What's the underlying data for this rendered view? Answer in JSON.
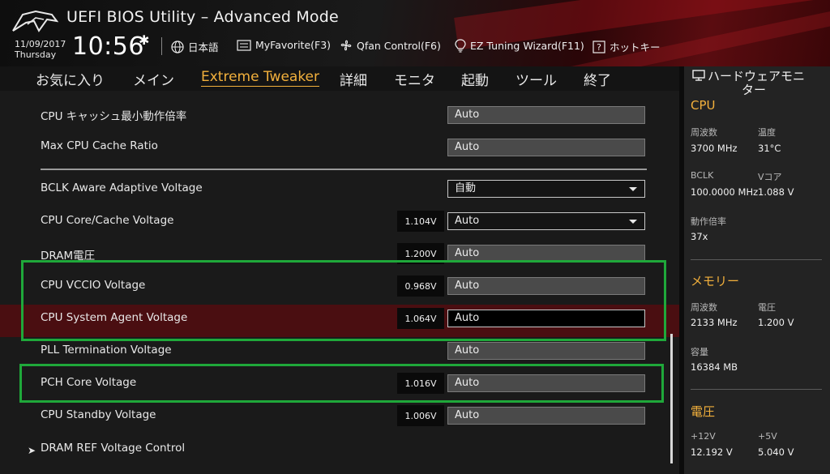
{
  "header": {
    "title": "UEFI BIOS Utility – Advanced Mode",
    "date": "11/09/2017",
    "day": "Thursday",
    "time": "10:56",
    "language": "日本語",
    "myfavorite": "MyFavorite(F3)",
    "qfan": "Qfan Control(F6)",
    "ez_tuning": "EZ Tuning Wizard(F11)",
    "hotkey": "ホットキー"
  },
  "nav": {
    "tabs": [
      "お気に入り",
      "メイン",
      "Extreme Tweaker",
      "詳細",
      "モニタ",
      "起動",
      "ツール",
      "終了"
    ],
    "active": "Extreme Tweaker"
  },
  "settings": [
    {
      "label": "CPU キャッシュ最小動作倍率",
      "value": "Auto"
    },
    {
      "label": "Max CPU Cache Ratio",
      "value": "Auto"
    },
    {
      "label": "BCLK Aware Adaptive Voltage",
      "value": "自動"
    },
    {
      "label": "CPU Core/Cache Voltage",
      "voltage": "1.104V",
      "value": "Auto"
    },
    {
      "label": "DRAM電圧",
      "voltage": "1.200V",
      "value": "Auto"
    },
    {
      "label": "CPU VCCIO Voltage",
      "voltage": "0.968V",
      "value": "Auto"
    },
    {
      "label": "CPU System Agent Voltage",
      "voltage": "1.064V",
      "value": "Auto"
    },
    {
      "label": "PLL Termination Voltage",
      "value": "Auto"
    },
    {
      "label": "PCH Core Voltage",
      "voltage": "1.016V",
      "value": "Auto"
    },
    {
      "label": "CPU Standby Voltage",
      "voltage": "1.006V",
      "value": "Auto"
    },
    {
      "label": "DRAM REF Voltage Control"
    }
  ],
  "hw_monitor": {
    "title_line1": "ハードウェアモニ",
    "title_line2": "ター",
    "cpu": {
      "heading": "CPU",
      "freq_label": "周波数",
      "freq": "3700 MHz",
      "temp_label": "温度",
      "temp": "31°C",
      "bclk_label": "BCLK",
      "bclk": "100.0000 MHz",
      "vcore_label": "Vコア",
      "vcore": "1.088 V",
      "ratio_label": "動作倍率",
      "ratio": "37x"
    },
    "memory": {
      "heading": "メモリー",
      "freq_label": "周波数",
      "freq": "2133 MHz",
      "volt_label": "電圧",
      "volt": "1.200 V",
      "cap_label": "容量",
      "cap": "16384 MB"
    },
    "voltage": {
      "heading": "電圧",
      "v12_label": "+12V",
      "v12": "12.192 V",
      "v5_label": "+5V",
      "v5": "5.040 V"
    }
  },
  "colors": {
    "accent": "#f2b03c",
    "highlight_row": "#4a0e11",
    "annotation_box": "#1fa83a"
  }
}
